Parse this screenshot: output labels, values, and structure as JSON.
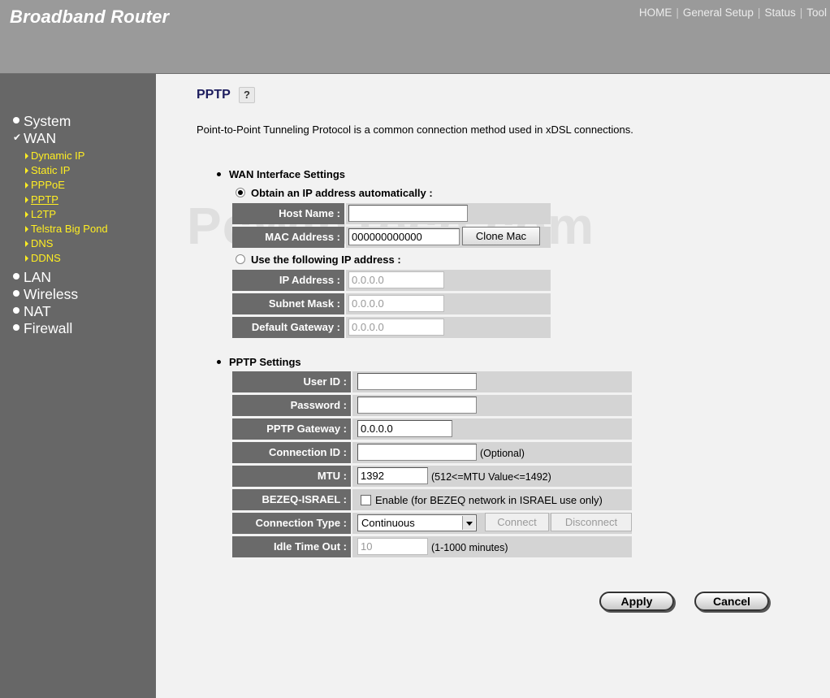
{
  "header": {
    "logo": "Broadband Router",
    "nav": [
      "HOME",
      "General Setup",
      "Status",
      "Tool"
    ]
  },
  "sidebar": {
    "system": "System",
    "wan": "WAN",
    "wan_sub": [
      "Dynamic IP",
      "Static IP",
      "PPPoE",
      "PPTP",
      "L2TP",
      "Telstra Big Pond",
      "DNS",
      "DDNS"
    ],
    "lan": "LAN",
    "wireless": "Wireless",
    "nat": "NAT",
    "firewall": "Firewall"
  },
  "page": {
    "title": "PPTP",
    "help_glyph": "?",
    "description": "Point-to-Point Tunneling Protocol is a common connection method used in xDSL connections.",
    "watermark": "PcWinTech.com"
  },
  "wan_settings": {
    "section_title": "WAN Interface Settings",
    "obtain_auto_label": "Obtain an IP address automatically :",
    "host_name_label": "Host Name :",
    "host_name_value": "",
    "mac_label": "MAC Address :",
    "mac_value": "000000000000",
    "clone_mac_label": "Clone Mac",
    "use_following_label": "Use the following IP address :",
    "ip_label": "IP Address :",
    "ip_value": "0.0.0.0",
    "subnet_label": "Subnet Mask :",
    "subnet_value": "0.0.0.0",
    "gateway_label": "Default Gateway :",
    "gateway_value": "0.0.0.0"
  },
  "pptp_settings": {
    "section_title": "PPTP Settings",
    "user_id_label": "User ID :",
    "user_id_value": "",
    "password_label": "Password :",
    "password_value": "",
    "gateway_label": "PPTP Gateway :",
    "gateway_value": "0.0.0.0",
    "conn_id_label": "Connection ID :",
    "conn_id_value": "",
    "conn_id_note": "(Optional)",
    "mtu_label": "MTU :",
    "mtu_value": "1392",
    "mtu_note": "(512<=MTU Value<=1492)",
    "bezeq_label": "BEZEQ-ISRAEL :",
    "bezeq_note": "Enable (for BEZEQ network in ISRAEL use only)",
    "conn_type_label": "Connection Type :",
    "conn_type_value": "Continuous",
    "connect_label": "Connect",
    "disconnect_label": "Disconnect",
    "idle_label": "Idle Time Out :",
    "idle_value": "10",
    "idle_note": "(1-1000 minutes)"
  },
  "actions": {
    "apply": "Apply",
    "cancel": "Cancel"
  }
}
